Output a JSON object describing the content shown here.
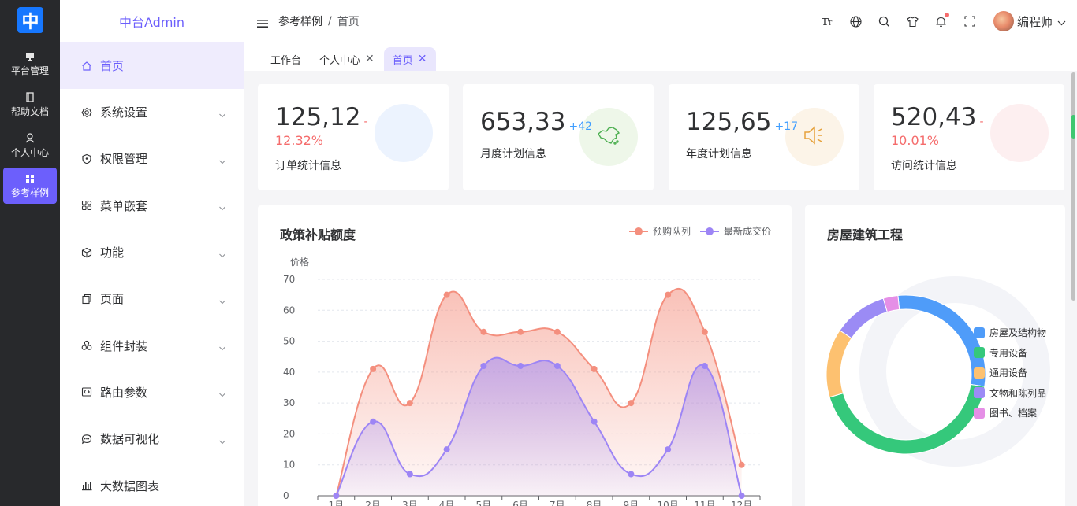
{
  "rail": {
    "logo": "中",
    "items": [
      {
        "label": "平台管理",
        "icon": "monitor-icon"
      },
      {
        "label": "帮助文档",
        "icon": "document-icon"
      },
      {
        "label": "个人中心",
        "icon": "user-icon"
      },
      {
        "label": "参考样例",
        "icon": "grid-icon"
      }
    ]
  },
  "menu": {
    "title": "中台Admin",
    "items": [
      {
        "label": "首页",
        "icon": "home-icon"
      },
      {
        "label": "系统设置",
        "icon": "settings-icon"
      },
      {
        "label": "权限管理",
        "icon": "shield-icon"
      },
      {
        "label": "菜单嵌套",
        "icon": "apps-icon"
      },
      {
        "label": "功能",
        "icon": "cube-icon"
      },
      {
        "label": "页面",
        "icon": "page-icon"
      },
      {
        "label": "组件封装",
        "icon": "shapes-icon"
      },
      {
        "label": "路由参数",
        "icon": "code-icon"
      },
      {
        "label": "数据可视化",
        "icon": "chat-icon"
      },
      {
        "label": "大数据图表",
        "icon": "bar-chart-icon"
      }
    ]
  },
  "header": {
    "breadcrumb": [
      "参考样例",
      "首页"
    ],
    "user_name": "编程师"
  },
  "tabs": [
    {
      "label": "工作台",
      "closable": false
    },
    {
      "label": "个人中心",
      "closable": true
    },
    {
      "label": "首页",
      "closable": true
    }
  ],
  "stats": [
    {
      "value": "125,12",
      "delta": "-",
      "pct": "12.32%",
      "label": "订单统计信息",
      "trend_color": "#f56c6c",
      "circle_color": "#ecf3fe"
    },
    {
      "value": "653,33",
      "delta": "+42",
      "pct": "",
      "label": "月度计划信息",
      "trend_color": "#409eff",
      "circle_color": "#eef7e9"
    },
    {
      "value": "125,65",
      "delta": "+17",
      "pct": "",
      "label": "年度计划信息",
      "trend_color": "#409eff",
      "circle_color": "#fcf4e8"
    },
    {
      "value": "520,43",
      "delta": "-",
      "pct": "10.01%",
      "label": "访问统计信息",
      "trend_color": "#f56c6c",
      "circle_color": "#fdeff0"
    }
  ],
  "line_panel": {
    "title": "政策补贴额度"
  },
  "donut_panel": {
    "title": "房屋建筑工程"
  },
  "chart_data": [
    {
      "type": "area",
      "title": "政策补贴额度",
      "ylabel": "价格",
      "xlabel": "",
      "ylim": [
        0,
        70
      ],
      "yticks": [
        0,
        10,
        20,
        30,
        40,
        50,
        60,
        70
      ],
      "categories": [
        "1月",
        "2月",
        "3月",
        "4月",
        "5月",
        "6月",
        "7月",
        "8月",
        "9月",
        "10月",
        "11月",
        "12月"
      ],
      "legend_position": "top-right",
      "grid": true,
      "smooth": true,
      "series": [
        {
          "name": "预购队列",
          "color": "#f48f7e",
          "values": [
            0,
            41,
            30,
            65,
            53,
            53,
            53,
            41,
            30,
            65,
            53,
            10
          ]
        },
        {
          "name": "最新成交价",
          "color": "#9d85f5",
          "values": [
            0,
            24,
            7,
            15,
            42,
            42,
            42,
            24,
            7,
            15,
            42,
            0
          ]
        }
      ]
    },
    {
      "type": "pie",
      "title": "房屋建筑工程",
      "donut": true,
      "legend_position": "right",
      "series": [
        {
          "name": "房屋及结构物",
          "color": "#4f9cf9",
          "value": 29
        },
        {
          "name": "专用设备",
          "color": "#35c87b",
          "value": 43
        },
        {
          "name": "通用设备",
          "color": "#fdc170",
          "value": 14
        },
        {
          "name": "文物和陈列品",
          "color": "#9b8bf5",
          "value": 11
        },
        {
          "name": "图书、档案",
          "color": "#e58fe6",
          "value": 3
        }
      ]
    }
  ]
}
